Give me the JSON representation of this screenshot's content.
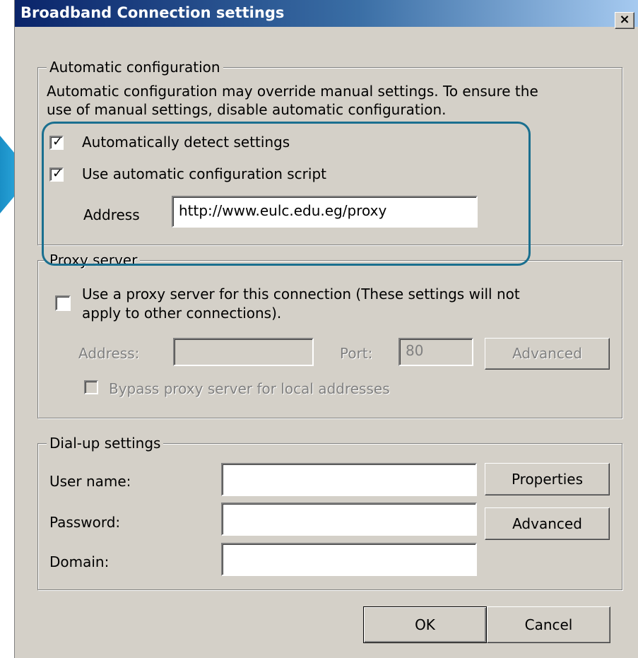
{
  "window": {
    "title": "Broadband Connection settings",
    "close_label": "×"
  },
  "auto_config": {
    "legend": "Automatic configuration",
    "description_line1": "Automatic configuration may override manual settings.  To ensure the",
    "description_line2": "use of manual settings, disable automatic configuration.",
    "detect_label": "Automatically detect settings",
    "detect_checked": true,
    "script_label": "Use automatic configuration script",
    "script_checked": true,
    "address_label": "Address",
    "address_value": "http://www.eulc.edu.eg/proxy"
  },
  "proxy": {
    "legend": "Proxy server",
    "use_proxy_line1": "Use a proxy server for this connection (These settings will not",
    "use_proxy_line2": "apply to other connections).",
    "use_proxy_checked": false,
    "address_label": "Address:",
    "address_value": "",
    "port_label": "Port:",
    "port_value": "80",
    "advanced_label": "Advanced",
    "bypass_label": "Bypass proxy server for local addresses",
    "bypass_checked": false
  },
  "dialup": {
    "legend": "Dial-up settings",
    "username_label": "User name:",
    "username_value": "",
    "password_label": "Password:",
    "password_value": "",
    "domain_label": "Domain:",
    "domain_value": "",
    "properties_label": "Properties",
    "advanced_label": "Advanced"
  },
  "footer": {
    "ok_label": "OK",
    "cancel_label": "Cancel"
  },
  "annotation": {
    "highlight_color": "#1a6f8f",
    "arrow_color": "#1e9fd8"
  }
}
